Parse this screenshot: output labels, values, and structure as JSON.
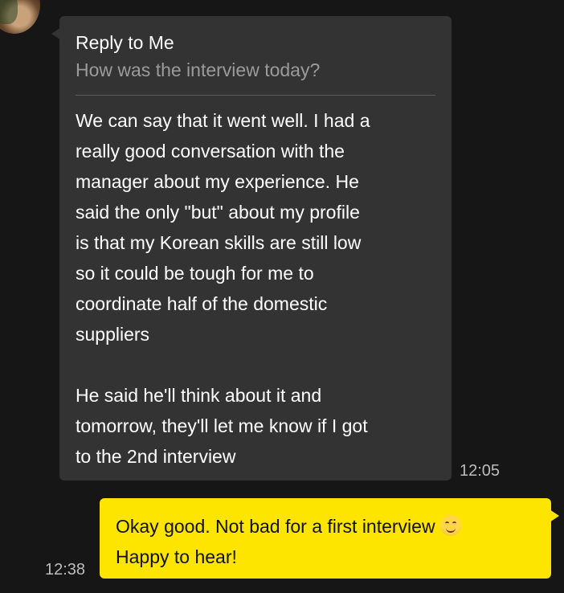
{
  "incoming": {
    "reply_title": "Reply to Me",
    "reply_quote": "How was the interview today?",
    "text_lines": [
      "We can say that it went well. I had a",
      "really good conversation with the",
      "manager about my experience. He",
      "said the only \"but\" about my profile",
      "is that my Korean skills are still low",
      "so it could be tough for me to",
      "coordinate half of the domestic",
      "suppliers",
      "",
      "He said he'll think about it and",
      "tomorrow, they'll let me know if I got",
      "to the 2nd interview"
    ],
    "time": "12:05"
  },
  "outgoing": {
    "line1": "Okay good. Not bad for a first interview",
    "emoji": "smiling-face-emoji",
    "line2": "Happy to hear!",
    "time": "12:38"
  },
  "colors": {
    "background": "#161616",
    "incoming_bubble": "#333333",
    "outgoing_bubble": "#fde500"
  }
}
